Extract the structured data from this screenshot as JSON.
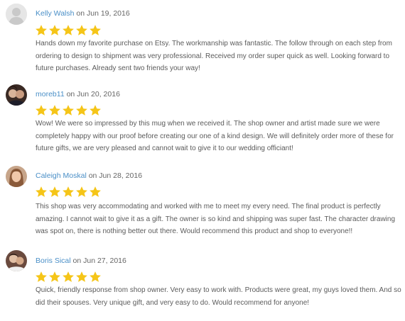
{
  "reviews": [
    {
      "author": "Kelly Walsh",
      "date_text": " on Jun 19, 2016",
      "rating": 5,
      "avatar_icon": "default-user-silhouette",
      "body": "Hands down my favorite purchase on Etsy. The workmanship was fantastic. The follow through on each step from ordering to design to shipment was very professional. Received my order super quick as well. Looking forward to future purchases. Already sent two friends your way!"
    },
    {
      "author": "moreb11",
      "date_text": " on Jun 20, 2016",
      "rating": 5,
      "avatar_icon": "user-photo",
      "body": "Wow! We were so impressed by this mug when we received it. The shop owner and artist made sure we were completely happy with our proof before creating our one of a kind design. We will definitely order more of these for future gifts, we are very pleased and cannot wait to give it to our wedding officiant!"
    },
    {
      "author": "Caleigh Moskal",
      "date_text": " on Jun 28, 2016",
      "rating": 5,
      "avatar_icon": "user-photo",
      "body": "This shop was very accommodating and worked with me to meet my every need. The final product is perfectly amazing. I cannot wait to give it as a gift. The owner is so kind and shipping was super fast. The character drawing was spot on, there is nothing better out there. Would recommend this product and shop to everyone!!"
    },
    {
      "author": "Boris Sical",
      "date_text": " on Jun 27, 2016",
      "rating": 5,
      "avatar_icon": "user-photo",
      "body": "Quick, friendly response from shop owner. Very easy to work with. Products were great, my guys loved them. And so did their spouses. Very unique gift, and very easy to do. Would recommend for anyone!"
    }
  ],
  "colors": {
    "author_link": "#4a8fc7",
    "star": "#f5c518",
    "text": "#5b5b5b"
  }
}
